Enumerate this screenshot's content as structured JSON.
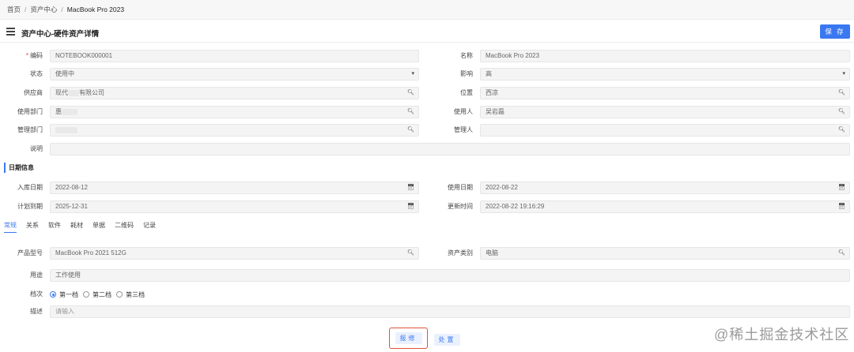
{
  "breadcrumb": {
    "home": "首页",
    "asset_center": "资产中心",
    "current": "MacBook Pro 2023",
    "sep": "/"
  },
  "header": {
    "title": "资产中心-硬件资产详情",
    "save_label": "保 存"
  },
  "basic": {
    "code_label": "编码",
    "code_value": "NOTEBOOK000001",
    "name_label": "名称",
    "name_value": "MacBook Pro 2023",
    "status_label": "状态",
    "status_value": "使用中",
    "impact_label": "影响",
    "impact_value": "高",
    "supplier_label": "供应商",
    "supplier_value_prefix": "现代",
    "supplier_value_suffix": "有限公司",
    "location_label": "位置",
    "location_value": "西凉",
    "dept_label": "使用部门",
    "dept_value": "惠",
    "user_label": "使用人",
    "user_value": "吴岩磊",
    "mgmt_dept_label": "管理部门",
    "mgmt_dept_value": "",
    "manager_label": "管理人",
    "manager_value": "",
    "desc_label": "说明",
    "desc_value": ""
  },
  "dates": {
    "section_title": "日期信息",
    "in_date_label": "入库日期",
    "in_date_value": "2022-08-12",
    "use_date_label": "使用日期",
    "use_date_value": "2022-08-22",
    "plan_expire_label": "计划到期",
    "plan_expire_value": "2025-12-31",
    "update_time_label": "更新时间",
    "update_time_value": "2022-08-22 19:16:29"
  },
  "tabs": [
    "常规",
    "关系",
    "软件",
    "耗材",
    "单据",
    "二维码",
    "记录"
  ],
  "general": {
    "model_label": "产品型号",
    "model_value": "MacBook Pro 2021 512G",
    "category_label": "资产类别",
    "category_value": "电脑",
    "purpose_label": "用途",
    "purpose_value": "工作使用",
    "grade_label": "档次",
    "grade_options": [
      "第一档",
      "第二档",
      "第三档"
    ],
    "grade_selected": "第一档",
    "remark_label": "描述",
    "remark_placeholder": "请输入"
  },
  "actions": {
    "repair_label": "报修",
    "dispose_label": "处置"
  },
  "icons": {
    "search": "search-icon",
    "calendar": "calendar-icon",
    "dropdown": "caret-down-icon",
    "menu": "hamburger-menu-icon"
  },
  "colors": {
    "primary": "#3a78f2",
    "required": "#e33333",
    "highlight_border": "#e0533a"
  },
  "watermark": "@稀土掘金技术社区"
}
